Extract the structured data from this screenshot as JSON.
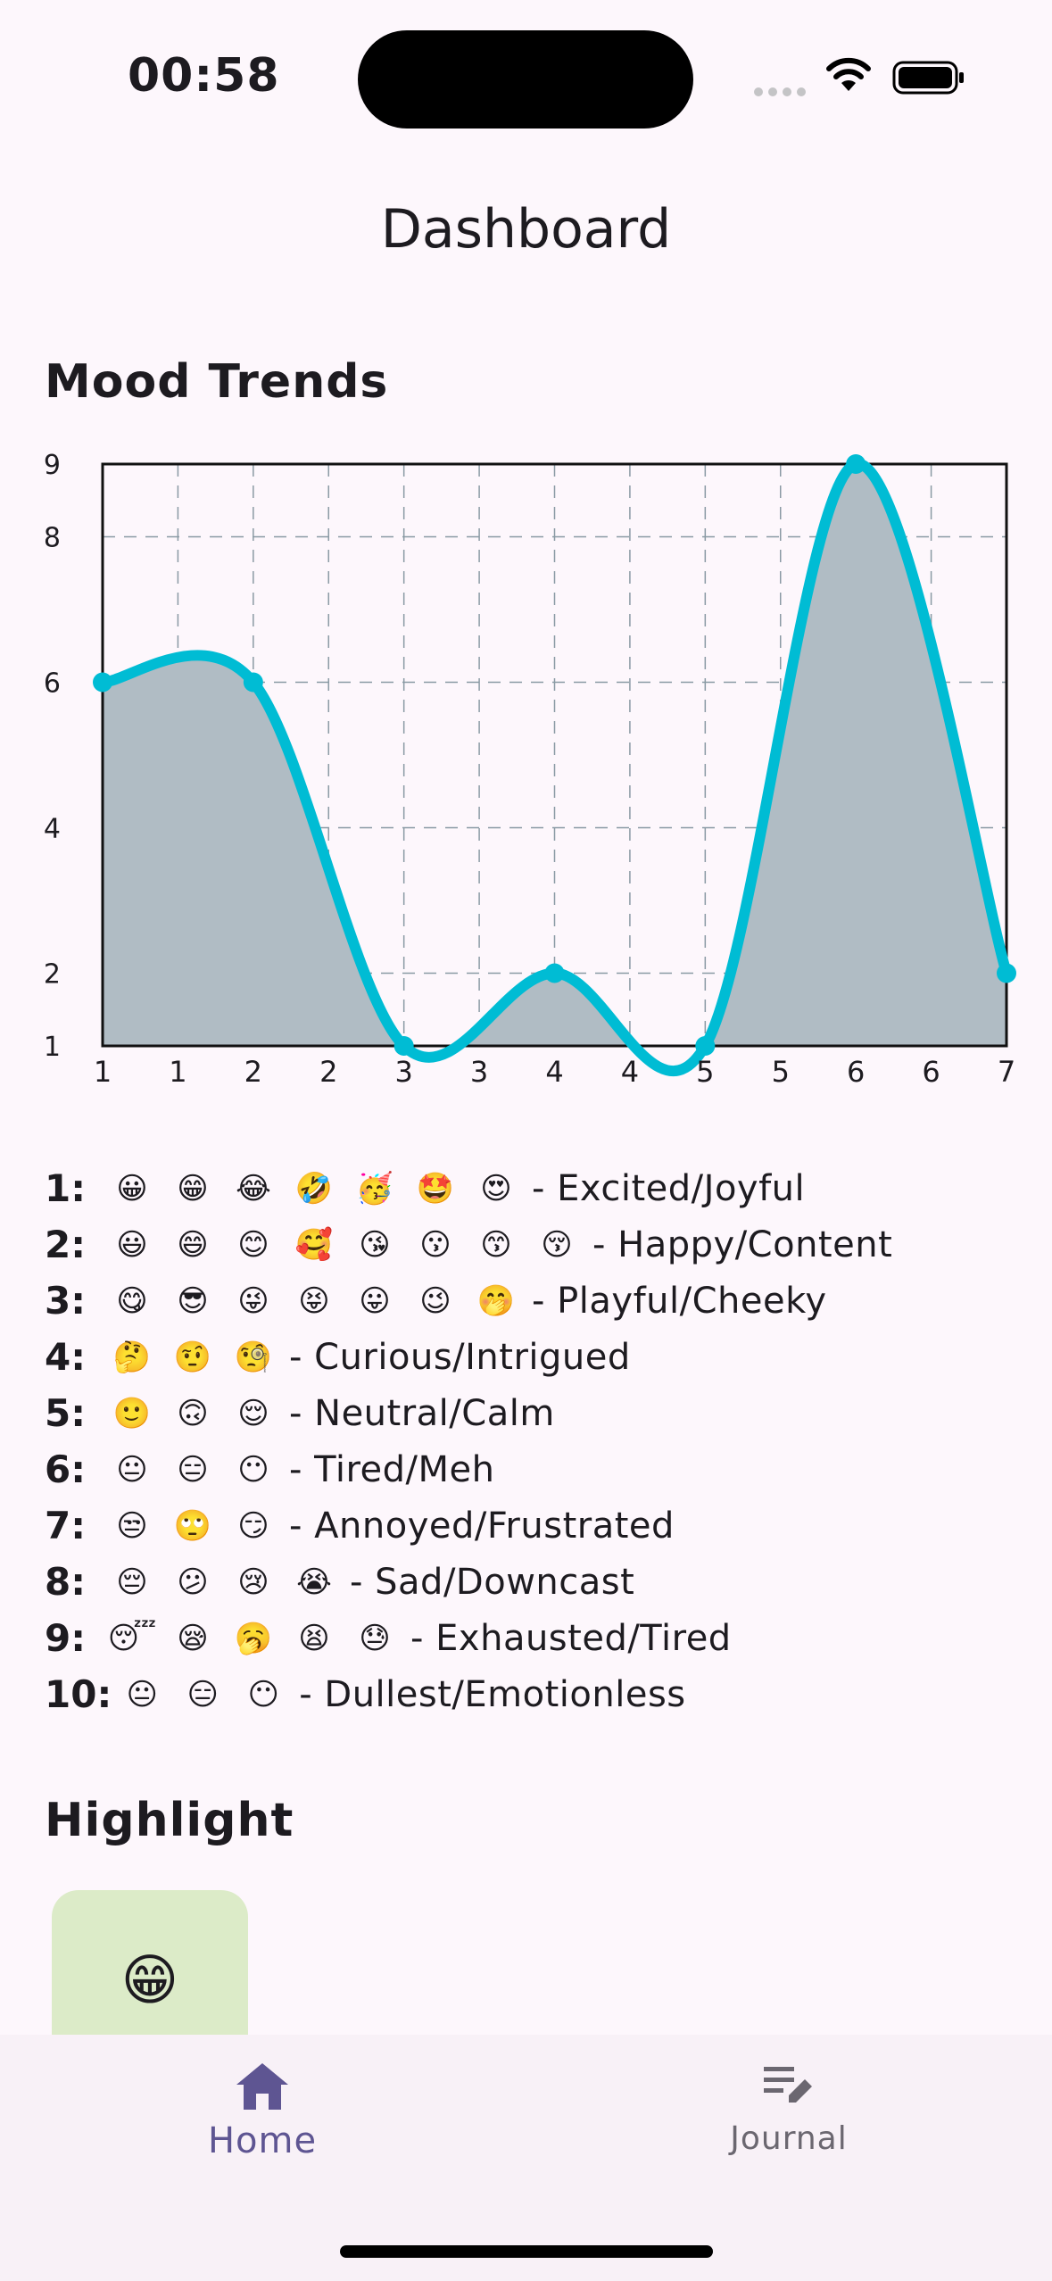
{
  "status": {
    "time": "00:58"
  },
  "header": {
    "title": "Dashboard"
  },
  "mood_section": {
    "title": "Mood Trends"
  },
  "chart_data": {
    "type": "area",
    "x": [
      1,
      2,
      3,
      4,
      5,
      6,
      7
    ],
    "values": [
      6,
      6,
      1,
      2,
      1,
      9,
      2
    ],
    "x_tick_labels": [
      "1",
      "1",
      "2",
      "2",
      "3",
      "3",
      "4",
      "4",
      "5",
      "5",
      "6",
      "6",
      "7"
    ],
    "y_tick_labels": [
      "1",
      "2",
      "4",
      "6",
      "8",
      "9"
    ],
    "ylim": [
      1,
      9
    ],
    "xlim": [
      1,
      7
    ],
    "grid": true,
    "line_color": "#00bcd4",
    "fill_color": "#b0bcc4"
  },
  "legend": [
    {
      "num": "1:",
      "emojis": [
        "😀",
        "😁",
        "😂",
        "🤣",
        "🥳",
        "🤩",
        "😍"
      ],
      "desc": "- Excited/Joyful"
    },
    {
      "num": "2:",
      "emojis": [
        "😃",
        "😄",
        "😊",
        "🥰",
        "😘",
        "😗",
        "😙",
        "😚"
      ],
      "desc": "- Happy/Content"
    },
    {
      "num": "3:",
      "emojis": [
        "😋",
        "😎",
        "😜",
        "😝",
        "😛",
        "😉",
        "🤭"
      ],
      "desc": "- Playful/Cheeky"
    },
    {
      "num": "4:",
      "emojis": [
        "🤔",
        "🤨",
        "🧐"
      ],
      "desc": "- Curious/Intrigued"
    },
    {
      "num": "5:",
      "emojis": [
        "🙂",
        "🙃",
        "😌"
      ],
      "desc": "- Neutral/Calm"
    },
    {
      "num": "6:",
      "emojis": [
        "😐",
        "😑",
        "😶"
      ],
      "desc": "- Tired/Meh"
    },
    {
      "num": "7:",
      "emojis": [
        "😒",
        "🙄",
        "😏"
      ],
      "desc": "- Annoyed/Frustrated"
    },
    {
      "num": "8:",
      "emojis": [
        "😔",
        "😕",
        "😢",
        "😭"
      ],
      "desc": "- Sad/Downcast"
    },
    {
      "num": "9:",
      "emojis": [
        "😴",
        "😪",
        "🥱",
        "😫",
        "😓"
      ],
      "desc": "- Exhausted/Tired"
    },
    {
      "num": "10:",
      "emojis": [
        "😐",
        "😑",
        "😶"
      ],
      "desc": "- Dullest/Emotionless"
    }
  ],
  "highlight": {
    "title": "Highlight",
    "emoji": "😁"
  },
  "nav": {
    "home_label": "Home",
    "journal_label": "Journal",
    "active_color": "#5e5592",
    "inactive_color": "#6b6770"
  }
}
